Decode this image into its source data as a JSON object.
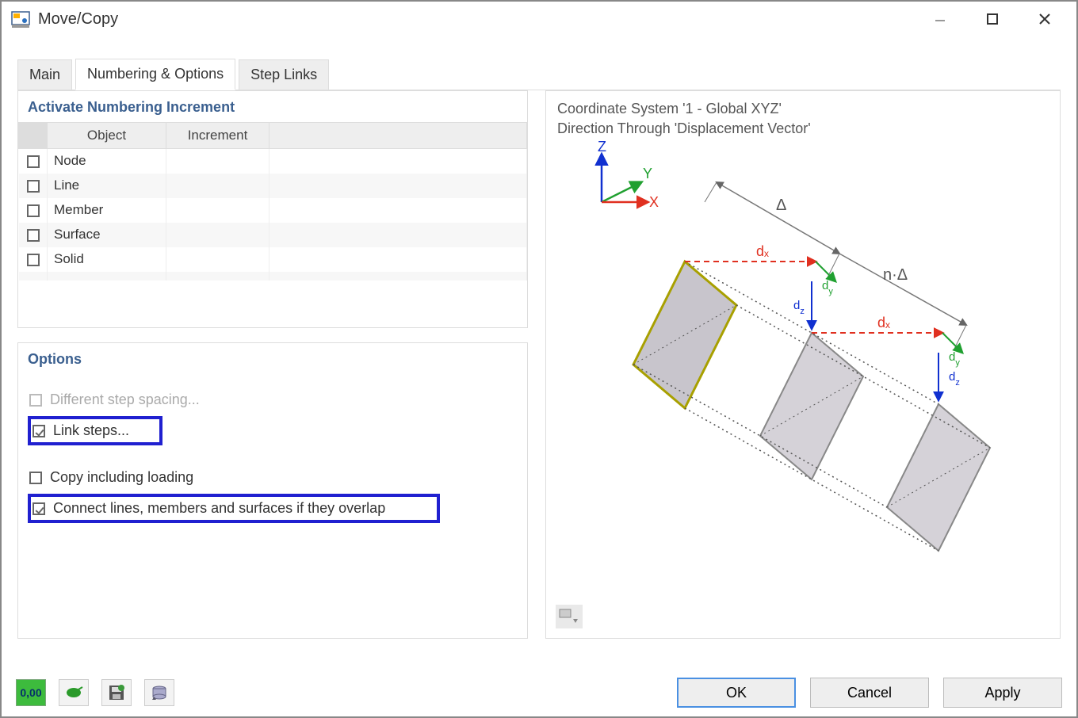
{
  "window": {
    "title": "Move/Copy"
  },
  "tabs": {
    "main": "Main",
    "numbering": "Numbering & Options",
    "steplinks": "Step Links",
    "active_index": 1
  },
  "numbering_panel": {
    "header": "Activate Numbering Increment",
    "col_object": "Object",
    "col_increment": "Increment",
    "rows": [
      {
        "label": "Node"
      },
      {
        "label": "Line"
      },
      {
        "label": "Member"
      },
      {
        "label": "Surface"
      },
      {
        "label": "Solid"
      }
    ]
  },
  "options_panel": {
    "header": "Options",
    "diff_step": "Different step spacing...",
    "link_steps": "Link steps...",
    "copy_loading": "Copy including loading",
    "connect_overlap": "Connect lines, members and surfaces if they overlap"
  },
  "preview": {
    "line1": "Coordinate System '1 - Global XYZ'",
    "line2": "Direction Through 'Displacement Vector'",
    "axis_z": "Z",
    "axis_y": "Y",
    "axis_x": "X",
    "delta": "Δ",
    "ndelta": "n·Δ",
    "dx": "dₓ",
    "dy": "dᵧ",
    "dz": "d_z"
  },
  "toolbar": {
    "icon_000": "0,00"
  },
  "buttons": {
    "ok": "OK",
    "cancel": "Cancel",
    "apply": "Apply"
  }
}
